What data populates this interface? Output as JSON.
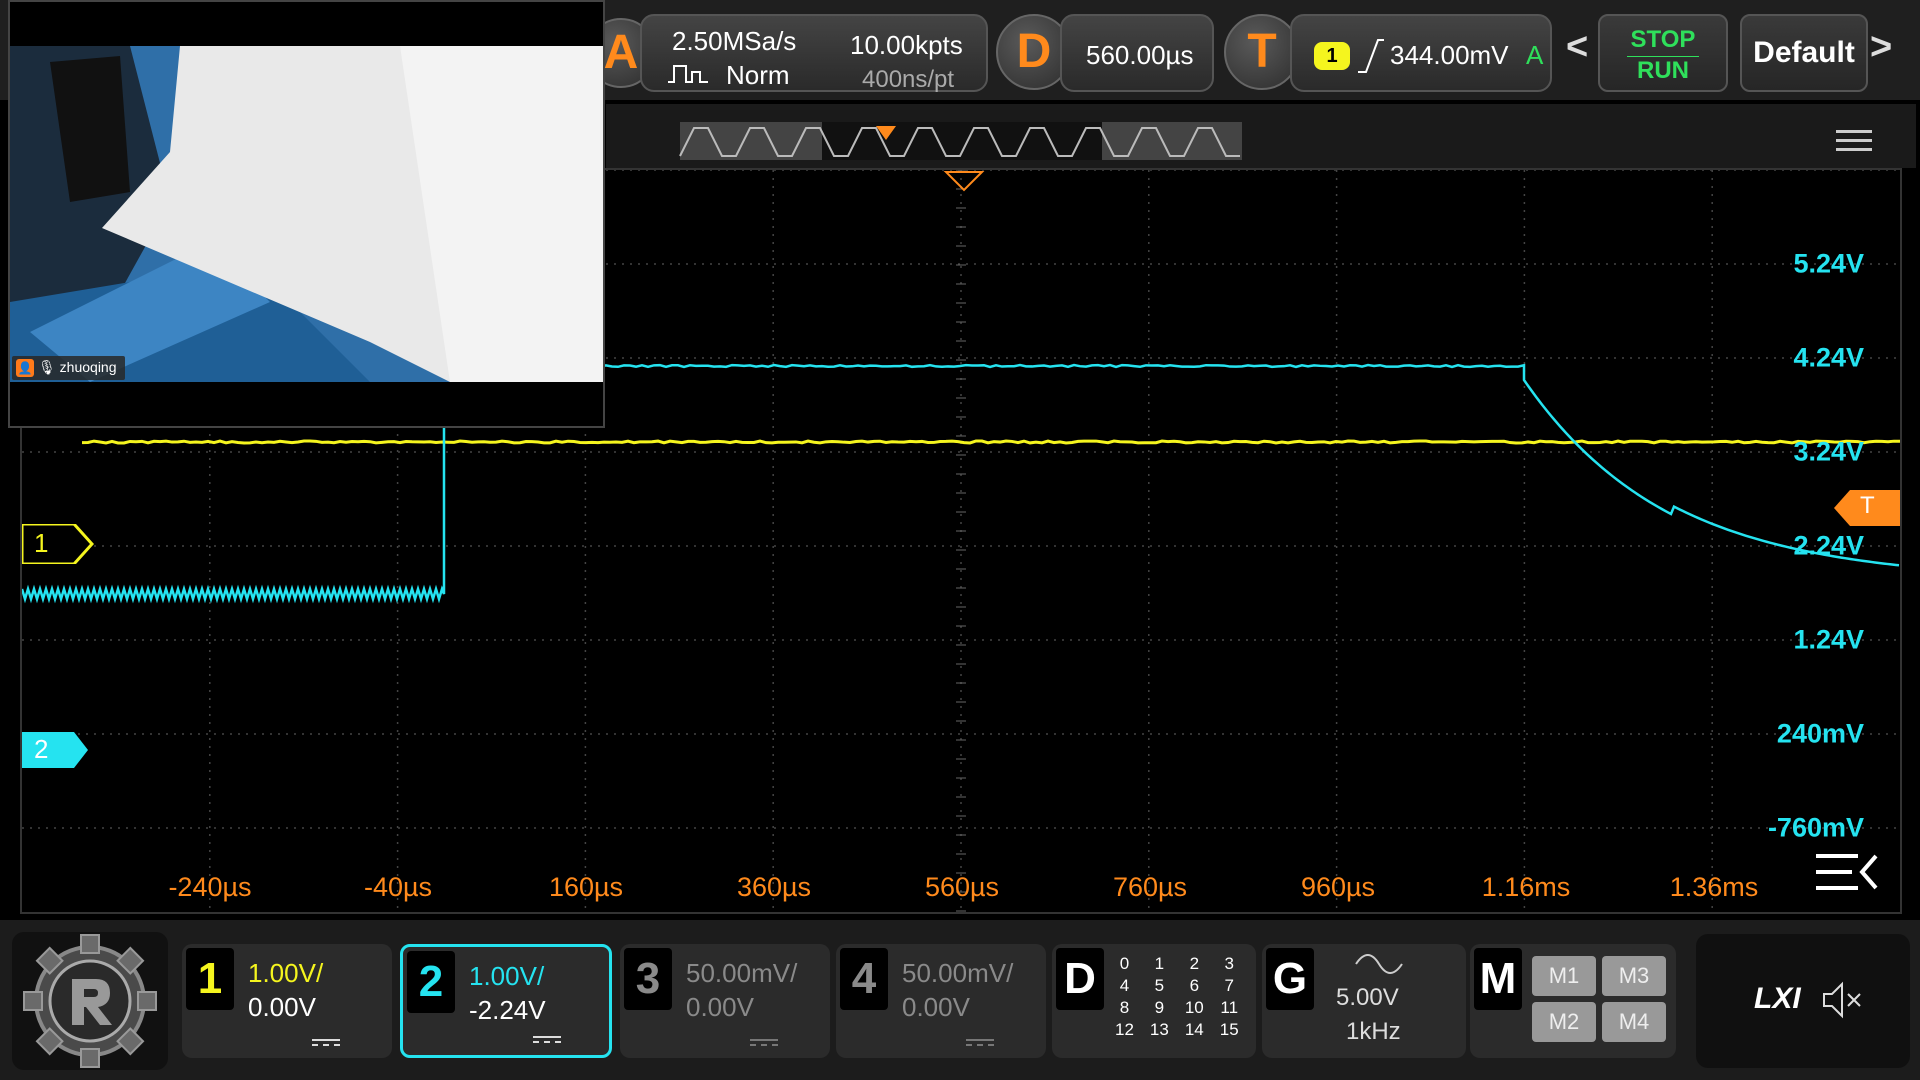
{
  "top_bar": {
    "acquire_button": "A",
    "sample_rate": "2.50MSa/s",
    "acq_mode": "Norm",
    "memory_depth": "10.00kpts",
    "time_per_point": "400ns/pt",
    "delay_button": "D",
    "delay_value": "560.00µs",
    "trigger_button": "T",
    "trigger_source": "1",
    "trigger_level": "344.00mV",
    "trigger_mode": "A",
    "stop_label": "STOP",
    "run_label": "RUN",
    "default_label": "Default",
    "prev_arrow": "<",
    "next_arrow": ">"
  },
  "camera_overlay": {
    "user_name": "zhuoqing"
  },
  "waveform": {
    "time_labels": [
      "-240µs",
      "-40µs",
      "160µs",
      "360µs",
      "560µs",
      "760µs",
      "960µs",
      "1.16ms",
      "1.36ms"
    ],
    "volt_labels": [
      "5.24V",
      "4.24V",
      "3.24V",
      "2.24V",
      "1.24V",
      "240mV",
      "-760mV"
    ],
    "ch1_marker": "1",
    "ch2_marker": "2",
    "trigger_marker": "T"
  },
  "channels": [
    {
      "num": "1",
      "scale": "1.00V/",
      "offset": "0.00V",
      "color": "#f5f51e",
      "active": false
    },
    {
      "num": "2",
      "scale": "1.00V/",
      "offset": "-2.24V",
      "color": "#25e3f0",
      "active": true
    },
    {
      "num": "3",
      "scale": "50.00mV/",
      "offset": "0.00V",
      "color": "#8a8a8a",
      "active": false
    },
    {
      "num": "4",
      "scale": "50.00mV/",
      "offset": "0.00V",
      "color": "#8a8a8a",
      "active": false
    }
  ],
  "digital": {
    "label": "D",
    "rows": [
      [
        "0",
        "1",
        "2",
        "3"
      ],
      [
        "4",
        "5",
        "6",
        "7"
      ],
      [
        "8",
        "9",
        "10",
        "11"
      ],
      [
        "12",
        "13",
        "14",
        "15"
      ]
    ]
  },
  "generator": {
    "label": "G",
    "amplitude": "5.00V",
    "frequency": "1kHz"
  },
  "math": {
    "label": "M",
    "buttons": [
      "M1",
      "M3",
      "M2",
      "M4"
    ]
  },
  "status": {
    "lxi": "LXI"
  },
  "colors": {
    "ch1": "#f5f51e",
    "ch2": "#25e3f0",
    "accent": "#ff8a1c",
    "run": "#2fe05b"
  }
}
